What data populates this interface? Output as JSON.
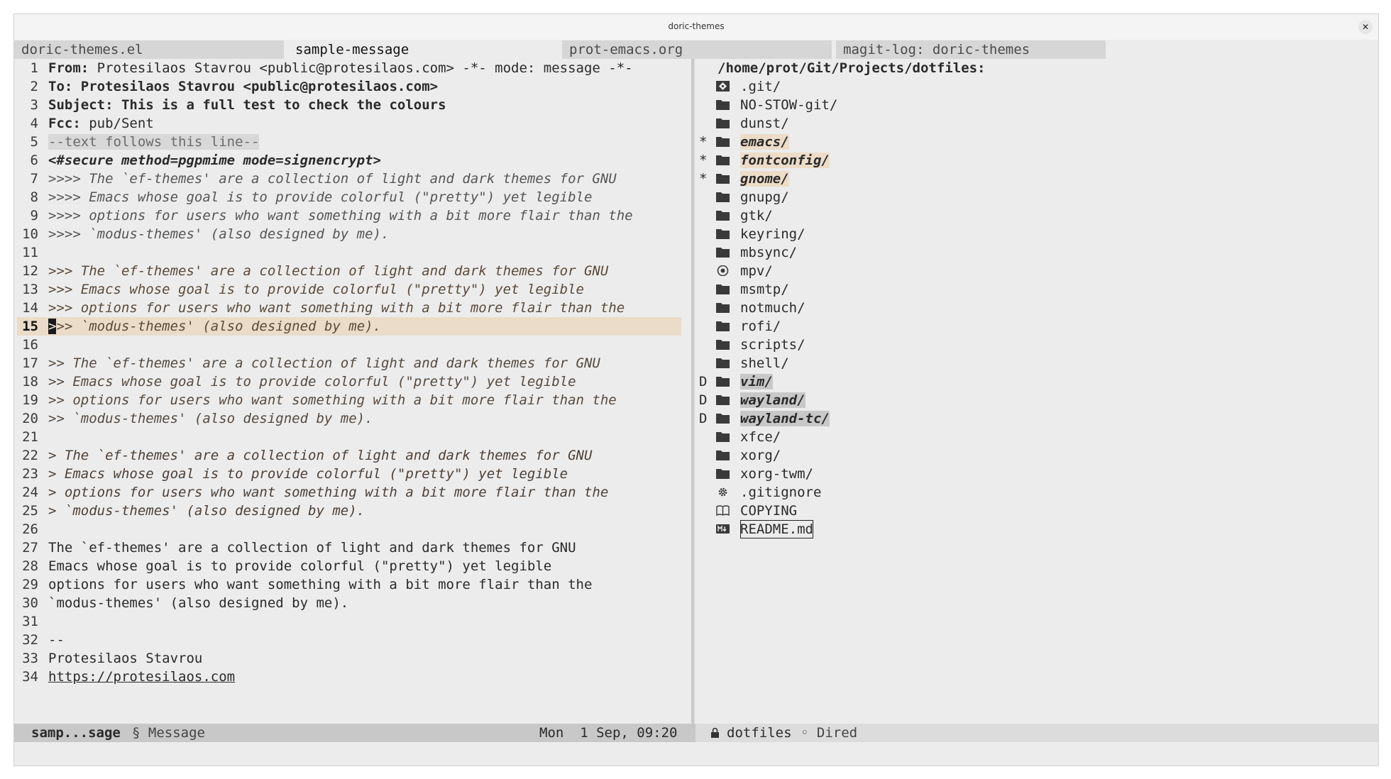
{
  "window": {
    "title": "doric-themes"
  },
  "tabs": [
    {
      "label": "doric-themes.el"
    },
    {
      "label": "sample-message"
    },
    {
      "label": "prot-emacs.org"
    },
    {
      "label": "magit-log: doric-themes"
    }
  ],
  "message": {
    "l1_key": "From:",
    "l1_val": " Protesilaos Stavrou <public@protesilaos.com> -*- mode: message -*-",
    "l2_key": "To:",
    "l2_val": " Protesilaos Stavrou <public@protesilaos.com>",
    "l3_key": "Subject:",
    "l3_val": " This is a full test to check the colours",
    "l4_key": "Fcc:",
    "l4_val": " pub/Sent",
    "l5": "--text follows this line--",
    "l6": "<#secure method=pgpmime mode=signencrypt>",
    "l7": ">>>> The `ef-themes' are a collection of light and dark themes for GNU",
    "l8": ">>>> Emacs whose goal is to provide colorful (\"pretty\") yet legible",
    "l9": ">>>> options for users who want something with a bit more flair than the",
    "l10": ">>>> `modus-themes' (also designed by me).",
    "l12": ">>> The `ef-themes' are a collection of light and dark themes for GNU",
    "l13": ">>> Emacs whose goal is to provide colorful (\"pretty\") yet legible",
    "l14": ">>> options for users who want something with a bit more flair than the",
    "l15a": ">",
    "l15b": ">> `modus-themes' (also designed by me).",
    "l17": ">> The `ef-themes' are a collection of light and dark themes for GNU",
    "l18": ">> Emacs whose goal is to provide colorful (\"pretty\") yet legible",
    "l19": ">> options for users who want something with a bit more flair than the",
    "l20": ">> `modus-themes' (also designed by me).",
    "l22": "> The `ef-themes' are a collection of light and dark themes for GNU",
    "l23": "> Emacs whose goal is to provide colorful (\"pretty\") yet legible",
    "l24": "> options for users who want something with a bit more flair than the",
    "l25": "> `modus-themes' (also designed by me).",
    "l27": "The `ef-themes' are a collection of light and dark themes for GNU",
    "l28": "Emacs whose goal is to provide colorful (\"pretty\") yet legible",
    "l29": "options for users who want something with a bit more flair than the",
    "l30": "`modus-themes' (also designed by me).",
    "l32": "--",
    "l33": "Protesilaos Stavrou",
    "l34": "https://protesilaos.com"
  },
  "line_numbers": [
    "1",
    "2",
    "3",
    "4",
    "5",
    "6",
    "7",
    "8",
    "9",
    "10",
    "11",
    "12",
    "13",
    "14",
    "15",
    "16",
    "17",
    "18",
    "19",
    "20",
    "21",
    "22",
    "23",
    "24",
    "25",
    "26",
    "27",
    "28",
    "29",
    "30",
    "31",
    "32",
    "33",
    "34"
  ],
  "dired": {
    "header": "/home/prot/Git/Projects/dotfiles:",
    "entries": [
      {
        "mark": "",
        "name": ".git/",
        "icon": "git-icon"
      },
      {
        "mark": "",
        "name": "NO-STOW-git/",
        "icon": "folder-icon"
      },
      {
        "mark": "",
        "name": "dunst/",
        "icon": "folder-icon"
      },
      {
        "mark": "*",
        "name": "emacs/",
        "icon": "folder-icon"
      },
      {
        "mark": "*",
        "name": "fontconfig/",
        "icon": "folder-icon"
      },
      {
        "mark": "*",
        "name": "gnome/",
        "icon": "folder-icon"
      },
      {
        "mark": "",
        "name": "gnupg/",
        "icon": "folder-icon"
      },
      {
        "mark": "",
        "name": "gtk/",
        "icon": "folder-icon"
      },
      {
        "mark": "",
        "name": "keyring/",
        "icon": "folder-icon"
      },
      {
        "mark": "",
        "name": "mbsync/",
        "icon": "folder-icon"
      },
      {
        "mark": "",
        "name": "mpv/",
        "icon": "disc-icon"
      },
      {
        "mark": "",
        "name": "msmtp/",
        "icon": "folder-icon"
      },
      {
        "mark": "",
        "name": "notmuch/",
        "icon": "folder-icon"
      },
      {
        "mark": "",
        "name": "rofi/",
        "icon": "folder-icon"
      },
      {
        "mark": "",
        "name": "scripts/",
        "icon": "folder-icon"
      },
      {
        "mark": "",
        "name": "shell/",
        "icon": "folder-icon"
      },
      {
        "mark": "D",
        "name": "vim/",
        "icon": "folder-icon"
      },
      {
        "mark": "D",
        "name": "wayland/",
        "icon": "folder-icon"
      },
      {
        "mark": "D",
        "name": "wayland-tc/",
        "icon": "folder-icon"
      },
      {
        "mark": "",
        "name": "xfce/",
        "icon": "folder-icon"
      },
      {
        "mark": "",
        "name": "xorg/",
        "icon": "folder-icon"
      },
      {
        "mark": "",
        "name": "xorg-twm/",
        "icon": "folder-icon"
      },
      {
        "mark": "",
        "name": ".gitignore",
        "icon": "gear-icon"
      },
      {
        "mark": "",
        "name": "COPYING",
        "icon": "book-icon"
      },
      {
        "mark": "",
        "name": "README.md",
        "icon": "markdown-icon"
      }
    ]
  },
  "modeline_left": {
    "buffer": "samp...sage",
    "mode": "§ Message",
    "date": "Mon  1 Sep, 09:20"
  },
  "modeline_right": {
    "buffer": "dotfiles",
    "mode": "◦ Dired"
  }
}
